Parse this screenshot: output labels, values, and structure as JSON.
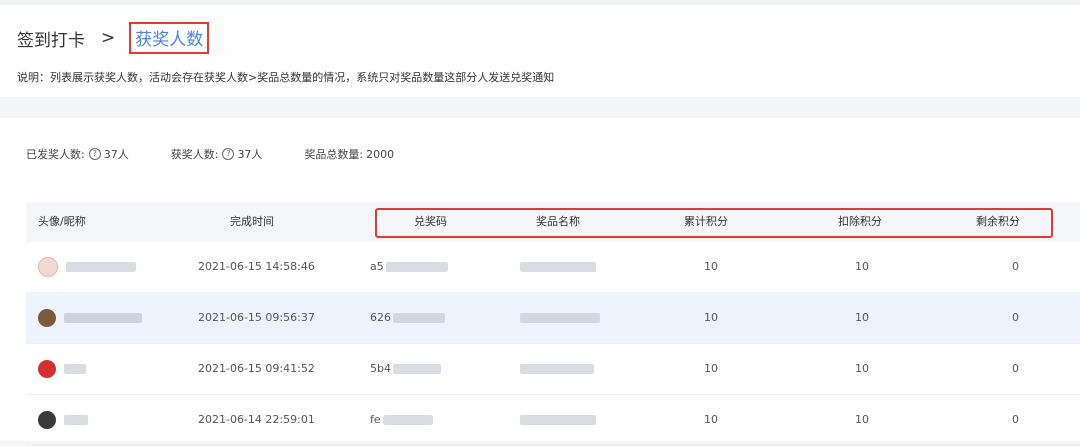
{
  "breadcrumb": {
    "root": "签到打卡",
    "separator": ">",
    "current": "获奖人数"
  },
  "description": "说明：列表展示获奖人数，活动会存在获奖人数>奖品总数量的情况，系统只对奖品数量这部分人发送兑奖通知",
  "stats": {
    "issued_label": "已发奖人数:",
    "issued_value": "37人",
    "winners_label": "获奖人数:",
    "winners_value": "37人",
    "prize_total_label": "奖品总数量:",
    "prize_total_value": "2000",
    "help_icon": "question-circle-icon"
  },
  "table": {
    "columns": [
      "头像/昵称",
      "完成时间",
      "兑奖码",
      "奖品名称",
      "累计积分",
      "扣除积分",
      "剩余积分"
    ],
    "rows": [
      {
        "time": "2021-06-15 14:58:46",
        "code_prefix": "a5",
        "total": "10",
        "deduct": "10",
        "remain": "0",
        "avatar_color": "#e8c7c0"
      },
      {
        "time": "2021-06-15 09:56:37",
        "code_prefix": "626",
        "total": "10",
        "deduct": "10",
        "remain": "0",
        "avatar_color": "#7a5a3a"
      },
      {
        "time": "2021-06-15 09:41:52",
        "code_prefix": "5b4",
        "total": "10",
        "deduct": "10",
        "remain": "0",
        "avatar_color": "#d62f2f"
      },
      {
        "time": "2021-06-14 22:59:01",
        "code_prefix": "fe",
        "total": "10",
        "deduct": "10",
        "remain": "0",
        "avatar_color": "#3a3a3a"
      }
    ]
  },
  "colors": {
    "accent": "#4b82f0",
    "highlight_border": "#e53935",
    "row_highlight": "#eef4ff"
  }
}
